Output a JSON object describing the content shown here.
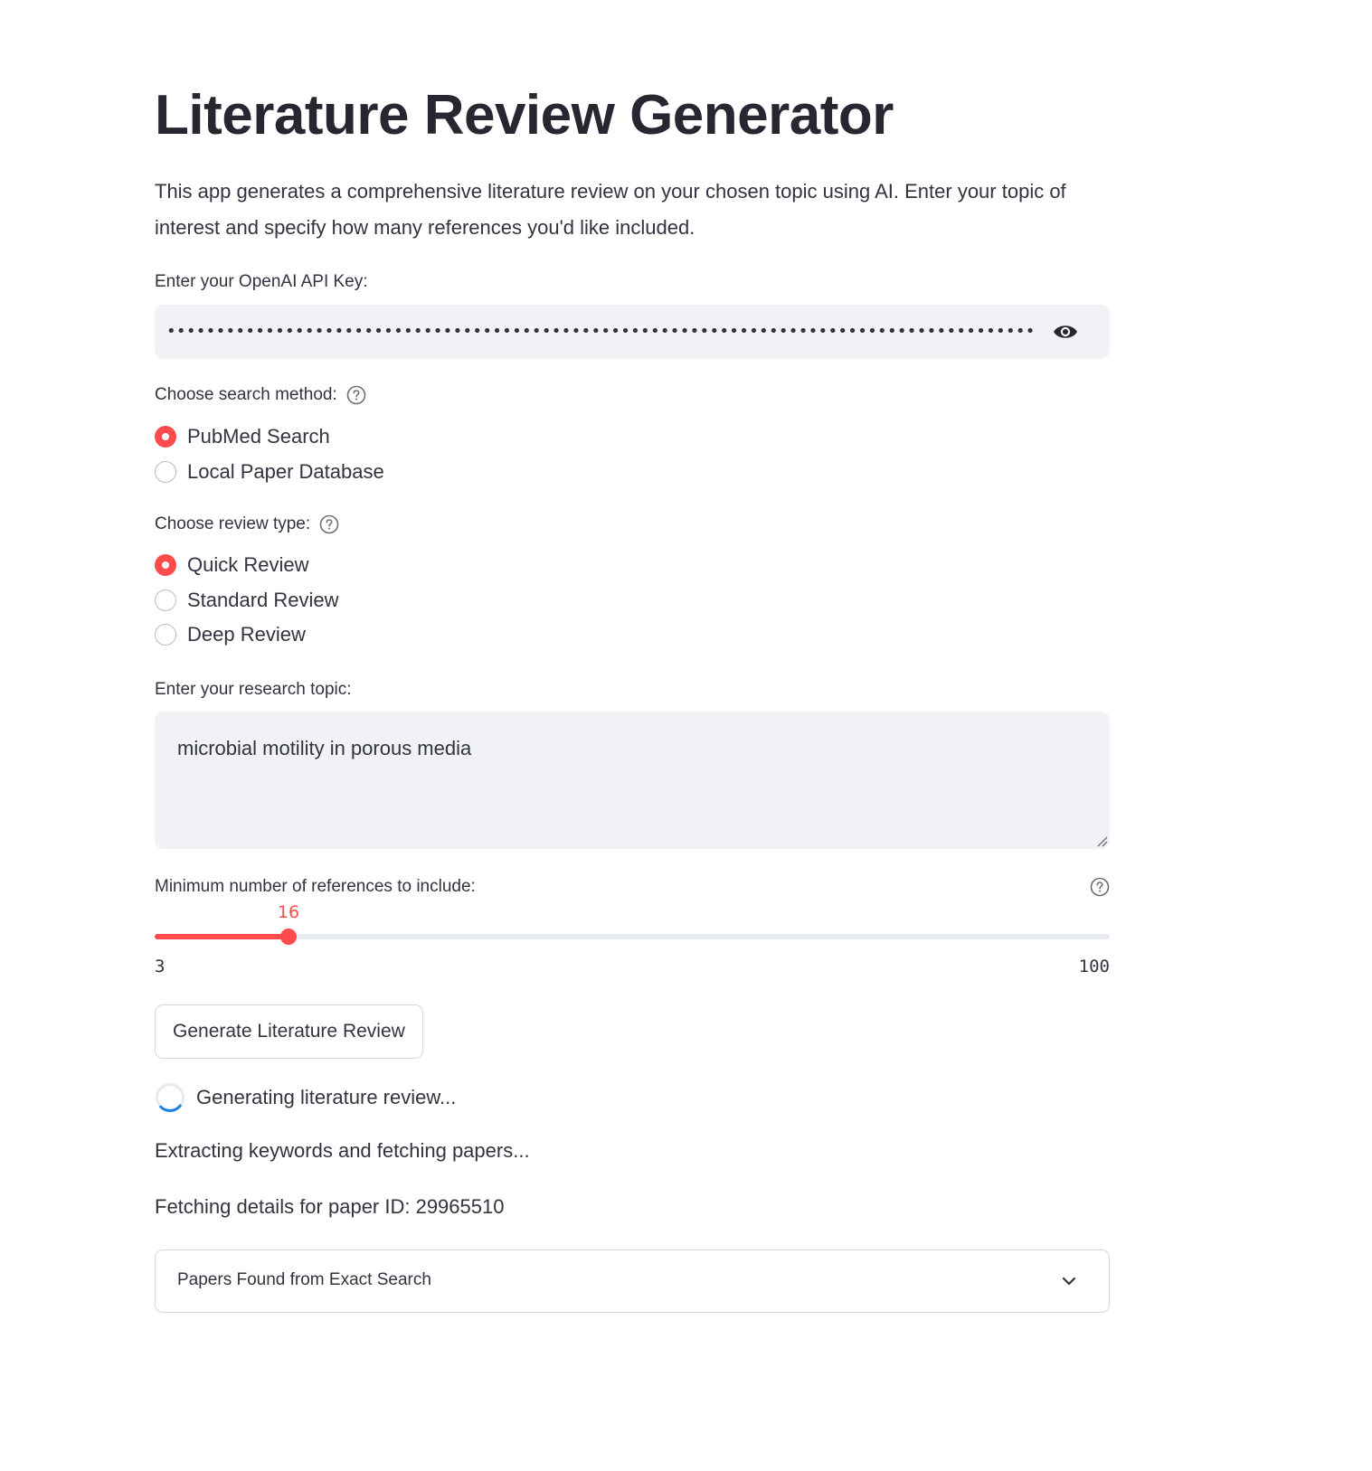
{
  "header": {
    "title": "Literature Review Generator",
    "description": "This app generates a comprehensive literature review on your chosen topic using AI. Enter your topic of interest and specify how many references you'd like included."
  },
  "api_key": {
    "label": "Enter your OpenAI API Key:",
    "masked_value": "•••••••••••••••••••••••••••••••••••••••••••••••••••••••••••••••••••••••••••••••••••••••••••••••••••••••••••••••••••••••••••••••••••••••••••••••",
    "reveal_icon": "eye-icon"
  },
  "search_method": {
    "label": "Choose search method:",
    "help_icon": "help-circle-icon",
    "options": [
      "PubMed Search",
      "Local Paper Database"
    ],
    "selected": "PubMed Search"
  },
  "review_type": {
    "label": "Choose review type:",
    "help_icon": "help-circle-icon",
    "options": [
      "Quick Review",
      "Standard Review",
      "Deep Review"
    ],
    "selected": "Quick Review"
  },
  "topic": {
    "label": "Enter your research topic:",
    "value": "microbial motility in porous media"
  },
  "references_slider": {
    "label": "Minimum number of references to include:",
    "help_icon": "help-circle-icon",
    "value": 16,
    "value_text": "16",
    "min": 3,
    "min_text": "3",
    "max": 100,
    "max_text": "100"
  },
  "generate_button": {
    "label": "Generate Literature Review"
  },
  "spinner": {
    "text": "Generating literature review...",
    "icon": "spinner-icon"
  },
  "status_messages": [
    "Extracting keywords and fetching papers...",
    "Fetching details for paper ID: 29965510"
  ],
  "expander": {
    "label": "Papers Found from Exact Search",
    "icon": "chevron-down-icon"
  },
  "colors": {
    "accent": "#ff4b4b",
    "text": "#31333f",
    "input_bg": "#f0f2f6",
    "spinner": "#1c83e1"
  }
}
